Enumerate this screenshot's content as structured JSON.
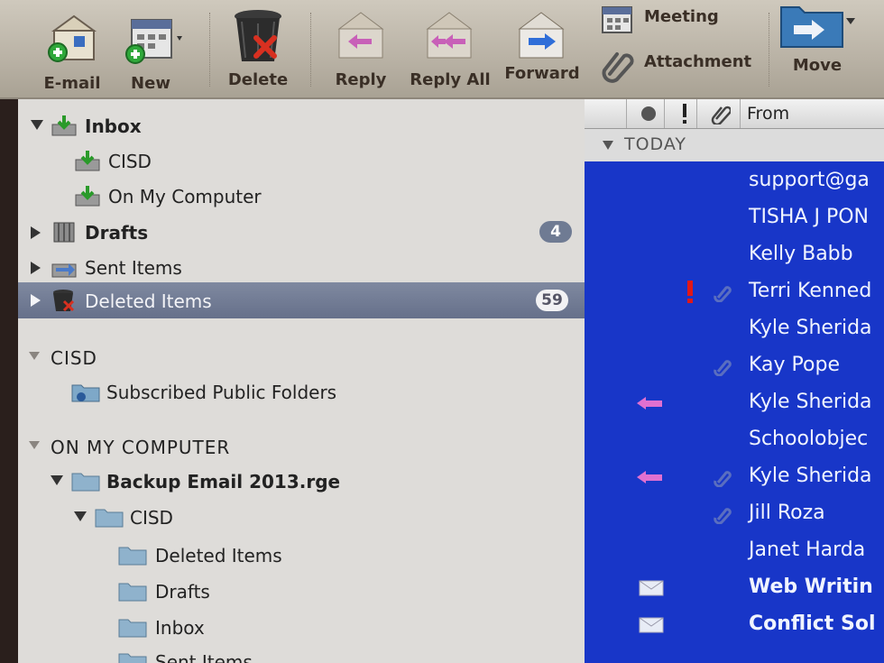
{
  "toolbar": {
    "email": "E-mail",
    "new": "New",
    "delete": "Delete",
    "reply": "Reply",
    "reply_all": "Reply All",
    "forward": "Forward",
    "meeting": "Meeting",
    "attachment": "Attachment",
    "move": "Move"
  },
  "sidebar": {
    "inbox": "Inbox",
    "inbox_cisd": "CISD",
    "inbox_on_my_computer": "On My Computer",
    "drafts": "Drafts",
    "drafts_count": "4",
    "sent_items": "Sent Items",
    "deleted_items": "Deleted Items",
    "deleted_count": "59",
    "section_cisd": "CISD",
    "subscribed_public_folders": "Subscribed Public Folders",
    "section_on_my_computer": "ON MY COMPUTER",
    "backup": "Backup Email 2013.rge",
    "backup_cisd": "CISD",
    "sub_deleted": "Deleted Items",
    "sub_drafts": "Drafts",
    "sub_inbox": "Inbox",
    "sub_sent": "Sent Items"
  },
  "list": {
    "header_from": "From",
    "group_today": "TODAY",
    "messages": [
      {
        "from": "support@ga"
      },
      {
        "from": "TISHA J PON"
      },
      {
        "from": "Kelly Babb"
      },
      {
        "from": "Terri Kenned"
      },
      {
        "from": "Kyle Sherida"
      },
      {
        "from": "Kay Pope"
      },
      {
        "from": "Kyle Sherida"
      },
      {
        "from": "Schoolobjec"
      },
      {
        "from": "Kyle Sherida"
      },
      {
        "from": "Jill Roza"
      },
      {
        "from": "Janet Harda"
      },
      {
        "from": "Web Writin"
      },
      {
        "from": "Conflict Sol"
      }
    ]
  },
  "colors": {
    "selection": "#66708a",
    "list_background": "#1836c8",
    "priority_flag": "#e01818",
    "reply_arrow": "#e070d0"
  }
}
